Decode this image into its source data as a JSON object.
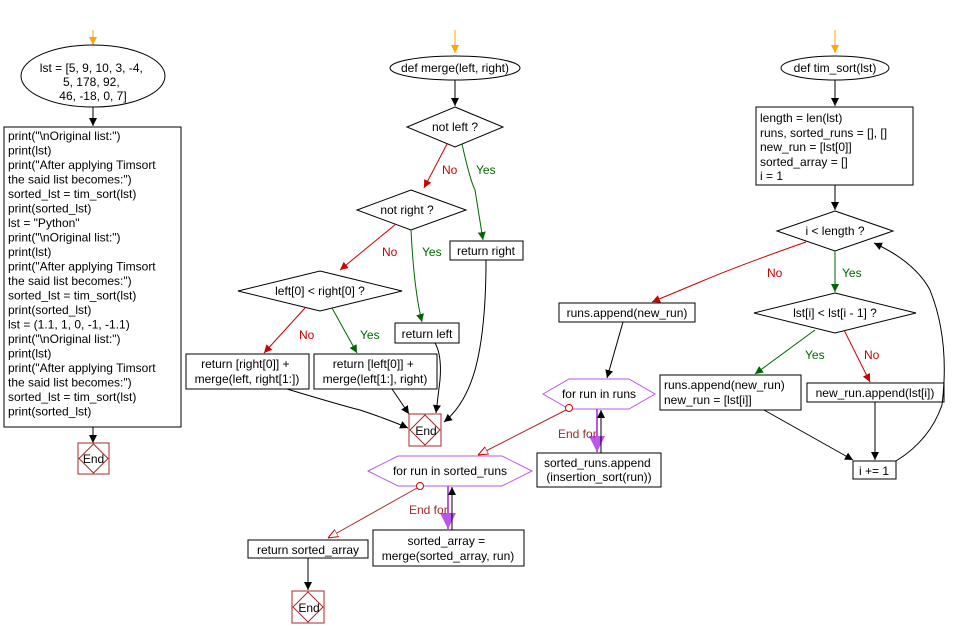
{
  "colors": {
    "yes": "#006600",
    "no": "#cc0000",
    "start_arrow": "#ffa500",
    "loop": "#bb55ee",
    "end": "#a52a2a"
  },
  "labels": {
    "yes": "Yes",
    "no": "No",
    "end_for": "End for",
    "end": "End"
  },
  "main": {
    "start_lines": [
      "lst = [5, 9, 10, 3, -4,",
      "5, 178, 92,",
      "46, -18, 0, 7]"
    ],
    "body_lines": [
      "print(\"\\nOriginal list:\")",
      "print(lst)",
      "print(\"After applying Timsort",
      "the said list becomes:\")",
      "sorted_lst = tim_sort(lst)",
      "print(sorted_lst)",
      "lst =  \"Python\"",
      "print(\"\\nOriginal list:\")",
      "print(lst)",
      "print(\"After applying Timsort",
      "the said list becomes:\")",
      "sorted_lst = tim_sort(lst)",
      "print(sorted_lst)",
      "lst = (1.1, 1, 0, -1, -1.1)",
      "print(\"\\nOriginal list:\")",
      "print(lst)",
      "print(\"After applying Timsort",
      "the said list becomes:\")",
      "sorted_lst = tim_sort(lst)",
      "print(sorted_lst)"
    ]
  },
  "merge": {
    "title": "def merge(left, right)",
    "cond_not_left": "not left ?",
    "cond_not_right": "not right ?",
    "cond_compare": "left[0] < right[0] ?",
    "return_right": "return right",
    "return_left": "return left",
    "return_right_merge": [
      "return [right[0]] +",
      "merge(left, right[1:])"
    ],
    "return_left_merge": [
      "return [left[0]] +",
      "merge(left[1:], right)"
    ]
  },
  "tim_sort": {
    "title": "def tim_sort(lst)",
    "init_lines": [
      "length = len(lst)",
      "runs, sorted_runs = [], []",
      "new_run = [lst[0]]",
      "sorted_array = []",
      "i = 1"
    ],
    "cond_loop": "i < length ?",
    "cond_compare": "lst[i] < lst[i - 1] ?",
    "append_last_run": "runs.append(new_run)",
    "new_run_lines": [
      "runs.append(new_run)",
      "new_run = [lst[i]]"
    ],
    "append_item": "new_run.append(lst[i])",
    "increment": "i += 1",
    "for_runs": "for run in runs",
    "sorted_runs_append": [
      "sorted_runs.append",
      "(insertion_sort(run))"
    ],
    "for_sorted_runs": "for run in sorted_runs",
    "merge_lines": [
      "sorted_array =",
      "merge(sorted_array, run)"
    ],
    "return_sorted": "return sorted_array"
  }
}
